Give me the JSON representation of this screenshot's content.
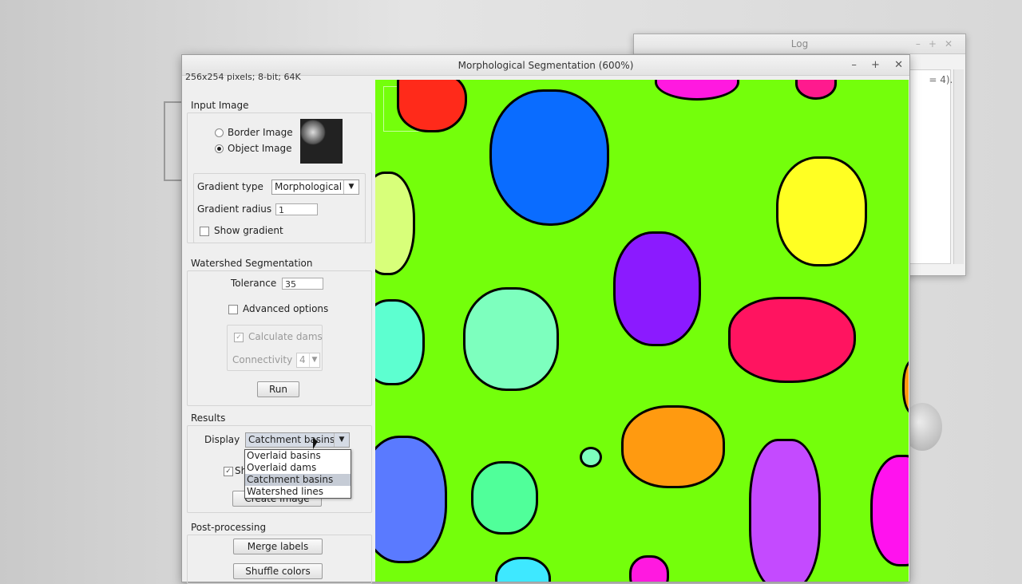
{
  "log_window": {
    "title": "Log",
    "text": "= 4)..."
  },
  "main_window": {
    "title": "Morphological Segmentation (600%)",
    "controls": [
      "–",
      "+",
      "✕"
    ],
    "image_info": "256x254 pixels; 8-bit; 64K"
  },
  "input_image": {
    "title": "Input Image",
    "border_label": "Border Image",
    "object_label": "Object Image",
    "selected": "Object Image",
    "gradient_type_label": "Gradient type",
    "gradient_type_value": "Morphological",
    "gradient_radius_label": "Gradient radius",
    "gradient_radius_value": "1",
    "show_gradient_label": "Show gradient"
  },
  "watershed": {
    "title": "Watershed Segmentation",
    "tolerance_label": "Tolerance",
    "tolerance_value": "35",
    "advanced_label": "Advanced options",
    "calc_dams_label": "Calculate dams",
    "connectivity_label": "Connectivity",
    "connectivity_value": "4",
    "run_label": "Run"
  },
  "results": {
    "title": "Results",
    "display_label": "Display",
    "display_value": "Catchment basins",
    "options": [
      "Overlaid basins",
      "Overlaid dams",
      "Catchment basins",
      "Watershed lines"
    ],
    "show_label_partial": "Sh",
    "create_image_label": "Create Image"
  },
  "post_processing": {
    "title": "Post-processing",
    "merge_label": "Merge labels",
    "shuffle_label": "Shuffle colors"
  },
  "colors": {
    "background": "#74ff0b",
    "basins": [
      "#ff2a1a",
      "#0a6cff",
      "#ff19e0",
      "#ff1a8e",
      "#ffff23",
      "#d8ff7a",
      "#8b1aff",
      "#ff1460",
      "#5dffd0",
      "#7dffbe",
      "#ff9a10",
      "#5a7aff",
      "#50ff9a",
      "#c44aff",
      "#ff12ee",
      "#3ee8ff"
    ]
  }
}
